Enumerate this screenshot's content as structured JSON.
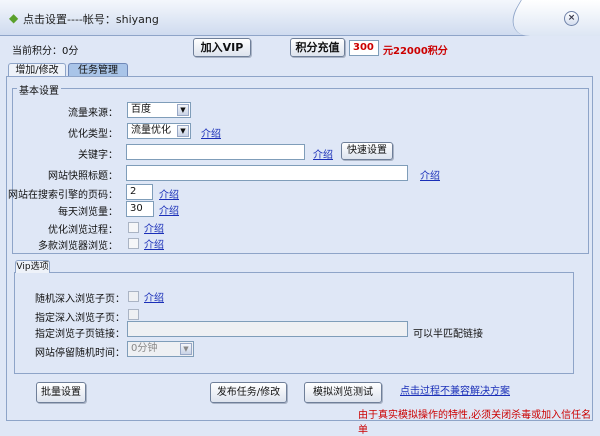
{
  "window": {
    "title": "点击设置----帐号：shiyang",
    "close_icon": "close-icon"
  },
  "header": {
    "points_label": "当前积分：0分",
    "vip_button": "加入VIP",
    "recharge_button": "积分充值",
    "recharge_amount": "300",
    "recharge_rate": "元22000积分"
  },
  "tabs": [
    {
      "label": "增加/修改",
      "selected": false
    },
    {
      "label": "任务管理",
      "selected": true
    }
  ],
  "basic": {
    "title": "基本设置",
    "traffic_source_label": "流量来源：",
    "traffic_source_value": "百度",
    "opt_type_label": "优化类型：",
    "opt_type_value": "流量优化",
    "keyword_label": "关键字：",
    "keyword_value": "",
    "quick_setup_button": "快速设置",
    "snapshot_title_label": "网站快照标题：",
    "snapshot_title_value": "",
    "page_num_label": "网站在搜索引擎的页码：",
    "page_num_value": "2",
    "daily_views_label": "每天浏览量：",
    "daily_views_value": "30",
    "opt_process_label": "优化浏览过程：",
    "multi_browser_label": "多款浏览器浏览：",
    "intro_link": "介绍"
  },
  "vip": {
    "title": "Vip选项",
    "random_deep_label": "随机深入浏览子页：",
    "fixed_deep_label": "指定深入浏览子页：",
    "subpage_link_label": "指定浏览子页链接：",
    "subpage_link_value": "",
    "subpage_hint": "可以半匹配链接",
    "stay_time_label": "网站停留随机时间：",
    "stay_time_value": "0分钟"
  },
  "footer": {
    "batch_button": "批量设置",
    "publish_button": "发布任务/修改",
    "simulate_button": "模拟浏览测试",
    "compat_link": "点击过程不兼容解决方案",
    "warning": "由于真实模拟操作的特性,必须关闭杀毒或加入信任名单"
  },
  "colors": {
    "red": "#cc0000",
    "link": "#1a2fb8",
    "tab_selected": "#a9c4e8"
  }
}
